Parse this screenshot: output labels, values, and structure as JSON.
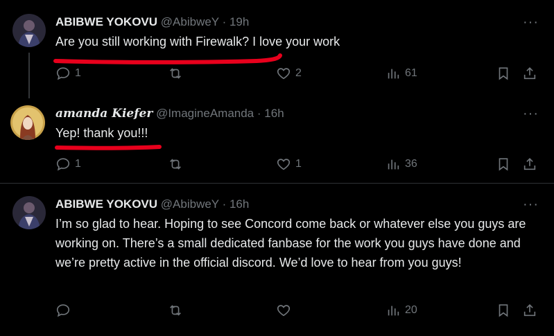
{
  "tweets": [
    {
      "name": "ABIBWE YOKOVU",
      "handle": "@AbibweY",
      "dot": "·",
      "time": "19h",
      "more": "···",
      "text": "Are you still working with Firewalk? I love your work",
      "replies": "1",
      "retweets": "",
      "likes": "2",
      "views": "61"
    },
    {
      "name": "amanda Kiefer",
      "handle": "@ImagineAmanda",
      "dot": "·",
      "time": "16h",
      "more": "···",
      "text": "Yep! thank you!!!",
      "replies": "1",
      "retweets": "",
      "likes": "1",
      "views": "36"
    },
    {
      "name": "ABIBWE YOKOVU",
      "handle": "@AbibweY",
      "dot": "·",
      "time": "16h",
      "more": "···",
      "text": "I’m so glad to hear. Hoping to see Concord come back or whatever else you guys are working on. There’s a small dedicated fanbase for the work you guys have done and we’re pretty active in the official discord. We’d love to hear from you guys!",
      "replies": "",
      "retweets": "",
      "likes": "",
      "views": "20"
    }
  ],
  "colors": {
    "background": "#000000",
    "text": "#e7e9ea",
    "muted": "#71767b",
    "annotation": "#e8001c"
  },
  "icons": [
    "reply-icon",
    "retweet-icon",
    "like-icon",
    "views-icon",
    "bookmark-icon",
    "share-icon",
    "more-icon"
  ]
}
